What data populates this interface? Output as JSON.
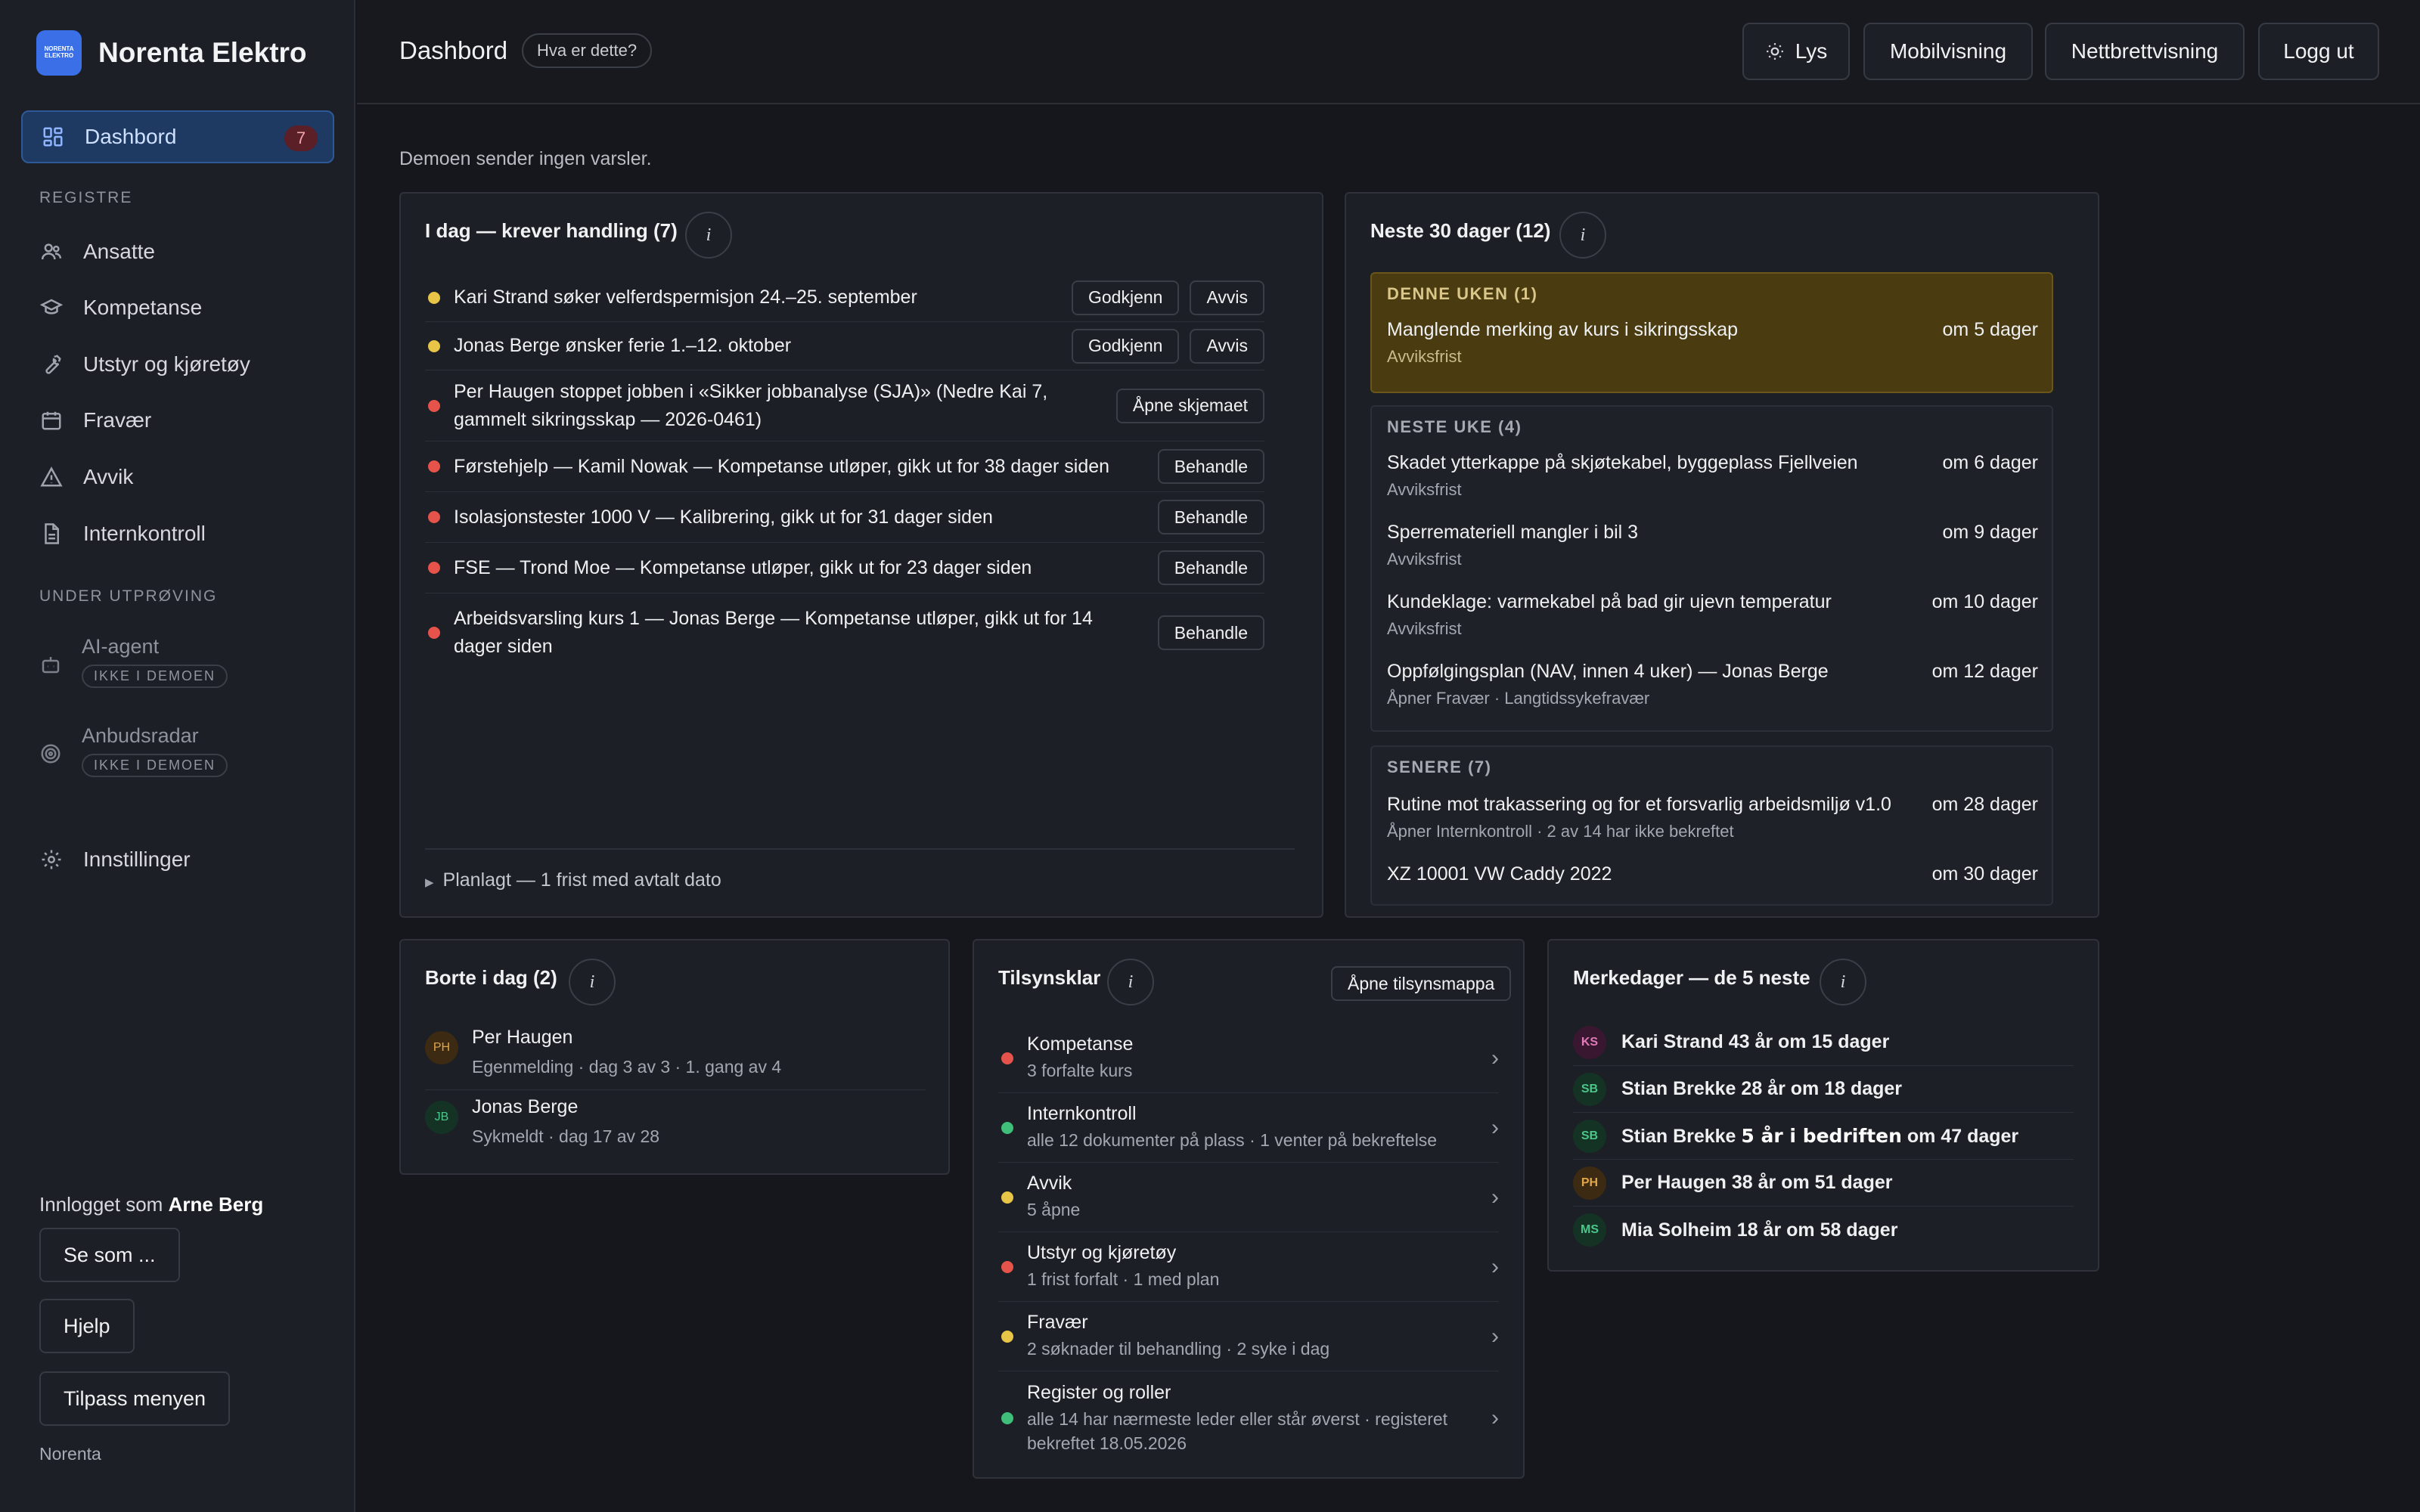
{
  "brand": {
    "name": "Norenta Elektro",
    "logo_line1": "NORENTA",
    "logo_line2": "ELEKTRO"
  },
  "sidebar": {
    "dashboard": {
      "label": "Dashbord",
      "badge": "7"
    },
    "section_registers": "REGISTRE",
    "items": [
      {
        "label": "Ansatte",
        "icon": "users-icon"
      },
      {
        "label": "Kompetanse",
        "icon": "graduation-cap-icon"
      },
      {
        "label": "Utstyr og kjøretøy",
        "icon": "wrench-icon"
      },
      {
        "label": "Fravær",
        "icon": "calendar-icon"
      },
      {
        "label": "Avvik",
        "icon": "warning-icon"
      },
      {
        "label": "Internkontroll",
        "icon": "document-icon"
      }
    ],
    "section_trial": "UNDER UTPRØVING",
    "trial_items": [
      {
        "label": "AI-agent",
        "tag": "IKKE I DEMOEN",
        "icon": "robot-icon"
      },
      {
        "label": "Anbudsradar",
        "tag": "IKKE I DEMOEN",
        "icon": "radar-icon"
      }
    ],
    "settings": {
      "label": "Innstillinger",
      "icon": "gear-icon"
    },
    "logged_in_prefix": "Innlogget som",
    "logged_in_user": "Arne Berg",
    "buttons": [
      "Se som ...",
      "Hjelp",
      "Tilpass menyen"
    ],
    "footer": "Norenta"
  },
  "topbar": {
    "title": "Dashbord",
    "help": "Hva er dette?",
    "buttons": {
      "theme": "Lys",
      "mobile": "Mobilvisning",
      "tablet": "Nettbrettvisning",
      "logout": "Logg ut"
    }
  },
  "notice": "Demoen sender ingen varsler.",
  "today": {
    "title": "I dag — krever handling (7)",
    "info": "i",
    "rows": [
      {
        "status": "y",
        "text": "Kari Strand søker velferdspermisjon 24.–25. september",
        "actions": [
          "Godkjenn",
          "Avvis"
        ]
      },
      {
        "status": "y",
        "text": "Jonas Berge ønsker ferie 1.–12. oktober",
        "actions": [
          "Godkjenn",
          "Avvis"
        ]
      },
      {
        "status": "r",
        "text": "Per Haugen stoppet jobben i «Sikker jobbanalyse (SJA)» (Nedre Kai 7, gammelt sikringsskap — 2026-0461)",
        "actions": [
          "Åpne skjemaet"
        ]
      },
      {
        "status": "r",
        "text": "Førstehjelp — Kamil Nowak — Kompetanse utløper, gikk ut for 38 dager siden",
        "actions": [
          "Behandle"
        ]
      },
      {
        "status": "r",
        "text": "Isolasjonstester 1000 V — Kalibrering, gikk ut for 31 dager siden",
        "actions": [
          "Behandle"
        ]
      },
      {
        "status": "r",
        "text": "FSE — Trond Moe — Kompetanse utløper, gikk ut for 23 dager siden",
        "actions": [
          "Behandle"
        ]
      },
      {
        "status": "r",
        "text": "Arbeidsvarsling kurs 1 — Jonas Berge — Kompetanse utløper, gikk ut for 14 dager siden",
        "actions": [
          "Behandle"
        ]
      }
    ],
    "planned": "Planlagt — 1 frist med avtalt dato"
  },
  "next30": {
    "title": "Neste 30 dager (12)",
    "info": "i",
    "groups": [
      {
        "head": "DENNE UKEN (1)",
        "items": [
          {
            "title": "Manglende merking av kurs i sikringsskap",
            "when": "om 5 dager",
            "sub": "Avviksfrist"
          }
        ]
      },
      {
        "head": "NESTE UKE (4)",
        "items": [
          {
            "title": "Skadet ytterkappe på skjøtekabel, byggeplass Fjellveien",
            "when": "om 6 dager",
            "sub": "Avviksfrist"
          },
          {
            "title": "Sperremateriell mangler i bil 3",
            "when": "om 9 dager",
            "sub": "Avviksfrist"
          },
          {
            "title": "Kundeklage: varmekabel på bad gir ujevn temperatur",
            "when": "om 10 dager",
            "sub": "Avviksfrist"
          },
          {
            "title": "Oppfølgingsplan (NAV, innen 4 uker) — Jonas Berge",
            "when": "om 12 dager",
            "sub": "Åpner Fravær · Langtidssykefravær"
          }
        ]
      },
      {
        "head": "SENERE (7)",
        "items": [
          {
            "title": "Rutine mot trakassering og for et forsvarlig arbeidsmiljø v1.0",
            "when": "om 28 dager",
            "sub": "Åpner Internkontroll · 2 av 14 har ikke bekreftet"
          },
          {
            "title": "XZ 10001 VW Caddy 2022",
            "when": "om 30 dager",
            "sub": ""
          }
        ]
      }
    ]
  },
  "absent": {
    "title": "Borte i dag (2)",
    "info": "i",
    "rows": [
      {
        "initials": "PH",
        "name": "Per Haugen",
        "sub": "Egenmelding · dag 3 av 3 · 1. gang av 4",
        "bg": "#3d2a12",
        "fg": "#e0a64a"
      },
      {
        "initials": "JB",
        "name": "Jonas Berge",
        "sub": "Sykmeldt · dag 17 av 28",
        "bg": "#143324",
        "fg": "#4cc68a"
      }
    ]
  },
  "supervision": {
    "title": "Tilsynsklar",
    "info": "i",
    "open_button": "Åpne tilsynsmappa",
    "rows": [
      {
        "status": "r",
        "title": "Kompetanse",
        "sub": "3 forfalte kurs"
      },
      {
        "status": "g",
        "title": "Internkontroll",
        "sub": "alle 12 dokumenter på plass · 1 venter på bekreftelse"
      },
      {
        "status": "y",
        "title": "Avvik",
        "sub": "5 åpne"
      },
      {
        "status": "r",
        "title": "Utstyr og kjøretøy",
        "sub": "1 frist forfalt · 1 med plan"
      },
      {
        "status": "y",
        "title": "Fravær",
        "sub": "2 søknader til behandling · 2 syke i dag"
      },
      {
        "status": "g",
        "title": "Register og roller",
        "sub": "alle 14 har nærmeste leder eller står øverst · registeret bekreftet 18.05.2026"
      }
    ]
  },
  "birthdays": {
    "title": "Merkedager — de 5 neste",
    "info": "i",
    "rows": [
      {
        "initials": "KS",
        "pre": "Kari Strand 43 år",
        "bold": "",
        "post": " om 15 dager",
        "bg": "#3a1730",
        "fg": "#e07ab8"
      },
      {
        "initials": "SB",
        "pre": "Stian Brekke 28 år",
        "bold": "",
        "post": " om 18 dager",
        "bg": "#143324",
        "fg": "#4cc68a"
      },
      {
        "initials": "SB",
        "pre": "Stian Brekke ",
        "bold": "5 år i bedriften",
        "post": " om 47 dager",
        "bg": "#143324",
        "fg": "#4cc68a"
      },
      {
        "initials": "PH",
        "pre": "Per Haugen 38 år",
        "bold": "",
        "post": " om 51 dager",
        "bg": "#3d2a12",
        "fg": "#e0a64a"
      },
      {
        "initials": "MS",
        "pre": "Mia Solheim 18 år",
        "bold": "",
        "post": " om 58 dager",
        "bg": "#143324",
        "fg": "#4cc68a"
      }
    ]
  }
}
